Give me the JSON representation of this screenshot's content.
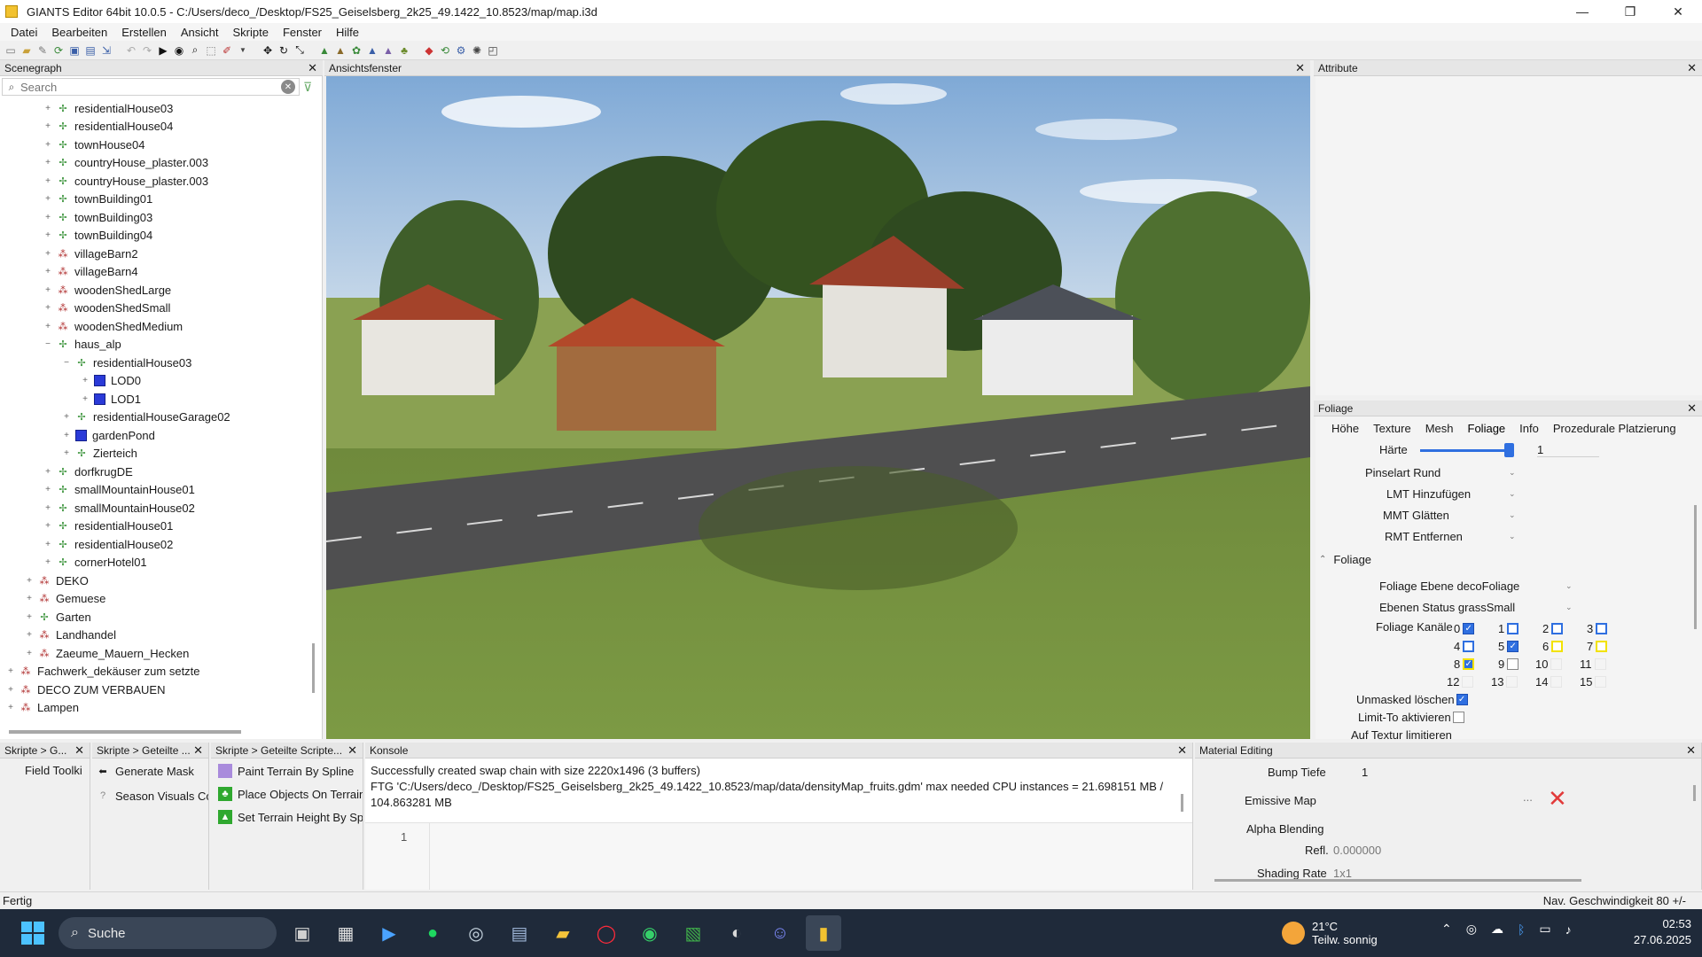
{
  "window": {
    "title": "GIANTS Editor 64bit 10.0.5 - C:/Users/deco_/Desktop/FS25_Geiselsberg_2k25_49.1422_10.8523/map/map.i3d",
    "minimize": "—",
    "maximize": "❐",
    "close": "✕"
  },
  "menu": [
    "Datei",
    "Bearbeiten",
    "Erstellen",
    "Ansicht",
    "Skripte",
    "Fenster",
    "Hilfe"
  ],
  "scenegraph": {
    "title": "Scenegraph",
    "search_placeholder": "Search",
    "items": [
      {
        "label": "residentialHouse03",
        "indent": 2,
        "icon": "node",
        "exp": "+"
      },
      {
        "label": "residentialHouse04",
        "indent": 2,
        "icon": "node",
        "exp": "+"
      },
      {
        "label": "townHouse04",
        "indent": 2,
        "icon": "node",
        "exp": "+"
      },
      {
        "label": "countryHouse_plaster.003",
        "indent": 2,
        "icon": "node",
        "exp": "+"
      },
      {
        "label": "countryHouse_plaster.003",
        "indent": 2,
        "icon": "node",
        "exp": "+"
      },
      {
        "label": "townBuilding01",
        "indent": 2,
        "icon": "node",
        "exp": "+"
      },
      {
        "label": "townBuilding03",
        "indent": 2,
        "icon": "node",
        "exp": "+"
      },
      {
        "label": "townBuilding04",
        "indent": 2,
        "icon": "node",
        "exp": "+"
      },
      {
        "label": "villageBarn2",
        "indent": 2,
        "icon": "group",
        "exp": "+"
      },
      {
        "label": "villageBarn4",
        "indent": 2,
        "icon": "group",
        "exp": "+"
      },
      {
        "label": "woodenShedLarge",
        "indent": 2,
        "icon": "group",
        "exp": "+"
      },
      {
        "label": "woodenShedSmall",
        "indent": 2,
        "icon": "group",
        "exp": "+"
      },
      {
        "label": "woodenShedMedium",
        "indent": 2,
        "icon": "group",
        "exp": "+"
      },
      {
        "label": "haus_alp",
        "indent": 2,
        "icon": "node",
        "exp": "−"
      },
      {
        "label": "residentialHouse03",
        "indent": 3,
        "icon": "node",
        "exp": "−"
      },
      {
        "label": "LOD0",
        "indent": 4,
        "icon": "mesh",
        "exp": "+"
      },
      {
        "label": "LOD1",
        "indent": 4,
        "icon": "mesh",
        "exp": "+"
      },
      {
        "label": "residentialHouseGarage02",
        "indent": 3,
        "icon": "node",
        "exp": "+"
      },
      {
        "label": "gardenPond",
        "indent": 3,
        "icon": "mesh",
        "exp": "+"
      },
      {
        "label": "Zierteich",
        "indent": 3,
        "icon": "node",
        "exp": "+"
      },
      {
        "label": "dorfkrugDE",
        "indent": 2,
        "icon": "node",
        "exp": "+"
      },
      {
        "label": "smallMountainHouse01",
        "indent": 2,
        "icon": "node",
        "exp": "+"
      },
      {
        "label": "smallMountainHouse02",
        "indent": 2,
        "icon": "node",
        "exp": "+"
      },
      {
        "label": "residentialHouse01",
        "indent": 2,
        "icon": "node",
        "exp": "+"
      },
      {
        "label": "residentialHouse02",
        "indent": 2,
        "icon": "node",
        "exp": "+"
      },
      {
        "label": "cornerHotel01",
        "indent": 2,
        "icon": "node",
        "exp": "+"
      },
      {
        "label": "DEKO",
        "indent": 1,
        "icon": "group",
        "exp": "+"
      },
      {
        "label": "Gemuese",
        "indent": 1,
        "icon": "group",
        "exp": "+"
      },
      {
        "label": "Garten",
        "indent": 1,
        "icon": "node",
        "exp": "+"
      },
      {
        "label": "Landhandel",
        "indent": 1,
        "icon": "group",
        "exp": "+"
      },
      {
        "label": "Zaeume_Mauern_Hecken",
        "indent": 1,
        "icon": "group",
        "exp": "+"
      },
      {
        "label": "Fachwerk_dekäuser zum setzte",
        "indent": 0,
        "icon": "group",
        "exp": "+"
      },
      {
        "label": "DECO ZUM VERBAUEN",
        "indent": 0,
        "icon": "group",
        "exp": "+"
      },
      {
        "label": "Lampen",
        "indent": 0,
        "icon": "group",
        "exp": "+"
      }
    ]
  },
  "viewport": {
    "title": "Ansichtsfenster"
  },
  "attribute": {
    "title": "Attribute"
  },
  "foliage": {
    "title": "Foliage",
    "tabs": [
      "Höhe",
      "Texture",
      "Mesh",
      "Foliage",
      "Info",
      "Prozedurale Platzierung"
    ],
    "haerte_label": "Härte",
    "haerte_value": "1",
    "haerte_level": 1,
    "combos": [
      "Pinselart Rund",
      "LMT Hinzufügen",
      "MMT Glätten",
      "RMT Entfernen"
    ],
    "section": "Foliage",
    "ebene": "Foliage Ebene decoFoliage",
    "status": "Ebenen Status grassSmall",
    "kanaele_label": "Foliage Kanäle",
    "channels": [
      {
        "n": "0",
        "state": "on"
      },
      {
        "n": "1",
        "state": "blueframe"
      },
      {
        "n": "2",
        "state": "blueframe"
      },
      {
        "n": "3",
        "state": "blueframe"
      },
      {
        "n": "4",
        "state": "blueframe"
      },
      {
        "n": "5",
        "state": "on"
      },
      {
        "n": "6",
        "state": "yellow"
      },
      {
        "n": "7",
        "state": "yellow"
      },
      {
        "n": "8",
        "state": "on-yellow"
      },
      {
        "n": "9",
        "state": "off"
      },
      {
        "n": "10",
        "state": "none"
      },
      {
        "n": "11",
        "state": "none"
      },
      {
        "n": "12",
        "state": "none"
      },
      {
        "n": "13",
        "state": "none"
      },
      {
        "n": "14",
        "state": "none"
      },
      {
        "n": "15",
        "state": "none"
      }
    ],
    "unmasked": "Unmasked löschen",
    "limit": "Limit-To aktivieren",
    "auf_textur": "Auf Textur limitieren"
  },
  "bottom": {
    "tab1": "Skripte > G...",
    "tab1_item": "Field Toolki",
    "tab2": "Skripte > Geteilte ...",
    "tab2_items": [
      "Generate Mask",
      "Season Visuals Co"
    ],
    "tab3": "Skripte > Geteilte Scripte...",
    "tab3_items": [
      "Paint Terrain By Spline",
      "Place Objects On Terrain",
      "Set Terrain Height By Sp"
    ],
    "console_title": "Konsole",
    "console_lines": [
      "Successfully created swap chain with size 2220x1496 (3 buffers)",
      "FTG 'C:/Users/deco_/Desktop/FS25_Geiselsberg_2k25_49.1422_10.8523/map/data/densityMap_fruits.gdm' max needed CPU instances = 21.698151 MB /",
      "104.863281 MB"
    ],
    "console_input_line": "1",
    "material_title": "Material Editing",
    "bump_label": "Bump Tiefe",
    "bump_value": "1",
    "emissive_label": "Emissive Map",
    "emissive_dots": "...",
    "alpha_label": "Alpha Blending",
    "refl_label": "Refl.",
    "refl_value": "0.000000",
    "shading_label": "Shading Rate",
    "shading_value": "1x1"
  },
  "status": {
    "left": "Fertig",
    "right": "Nav. Geschwindigkeit 80 +/-"
  },
  "taskbar": {
    "search": "Suche",
    "temp": "21°C",
    "weather": "Teilw. sonnig",
    "time": "02:53",
    "date": "27.06.2025"
  }
}
